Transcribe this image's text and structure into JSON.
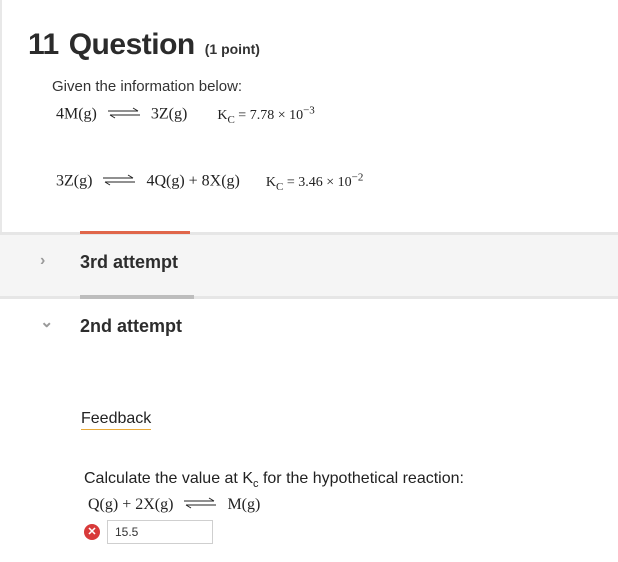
{
  "question": {
    "number": "11",
    "title": "Question",
    "points": "(1 point)",
    "intro": "Given the information below:",
    "equations": [
      {
        "left": "4M(g)",
        "right": "3Z(g)",
        "kc_label": "K",
        "kc_sub": "C",
        "kc_value": "= 7.78 × 10",
        "kc_exp": "−3"
      },
      {
        "left": "3Z(g)",
        "right": "4Q(g) + 8X(g)",
        "kc_label": "K",
        "kc_sub": "C",
        "kc_value": "= 3.46 × 10",
        "kc_exp": "−2"
      }
    ]
  },
  "attempts": [
    {
      "label": "3rd attempt",
      "chevron": "›",
      "state": "collapsed"
    },
    {
      "label": "2nd attempt",
      "chevron": "⌄",
      "state": "expanded"
    }
  ],
  "feedback": {
    "link_label": "Feedback",
    "prompt_before": "Calculate the value at K",
    "prompt_sub": "c",
    "prompt_after": " for the hypothetical reaction:",
    "reaction_left": "Q(g) + 2X(g)",
    "reaction_right": "M(g)",
    "answer_value": "15.5",
    "answer_status_icon": "x-circle-icon",
    "answer_status_glyph": "✕"
  },
  "colors": {
    "accent": "#e0664a",
    "incorrect": "#d83a3a",
    "feedback_underline": "#e8a93a"
  }
}
